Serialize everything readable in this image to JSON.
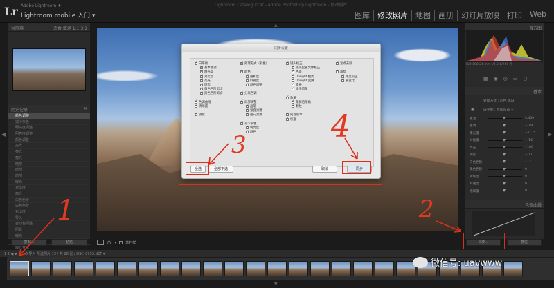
{
  "window_title": "Lightroom Catalog.lrcat - Adobe Photoshop Lightroom - 修改照片",
  "app": {
    "logo": "Lr",
    "subtitle": "Adobe Lightroom ♦",
    "identity": "Lightroom mobile 入门 ▾"
  },
  "nav": {
    "items": [
      {
        "label": "图库",
        "active": false
      },
      {
        "label": "修改照片",
        "active": true
      },
      {
        "label": "地图",
        "active": false
      },
      {
        "label": "画册",
        "active": false
      },
      {
        "label": "幻灯片放映",
        "active": false
      },
      {
        "label": "打印",
        "active": false
      },
      {
        "label": "Web",
        "active": false
      }
    ]
  },
  "left_panel": {
    "navigator_title": "导航器",
    "navigator_zoom": "适合 填满 1:1 3:1",
    "history_title": "历史记录",
    "history_items": [
      "颜色调整",
      "减少杂色",
      "明亮度调整",
      "明亮度调整",
      "颜色调整",
      "亮光",
      "亮光",
      "亮光",
      "暗部",
      "暗部",
      "暗部",
      "曝光",
      "对比度",
      "高光",
      "白色色阶",
      "白色色阶",
      "对比度",
      "导入",
      "自动色调整",
      "阴影",
      "曝光",
      "高光",
      "曝光变化",
      "曝光变化",
      "色温",
      "色调"
    ],
    "copy_button": "复制...",
    "paste_button": "粘贴"
  },
  "dialog": {
    "title": "同步设置",
    "col1": [
      "白平衡",
      "基本色调",
      "曝光度",
      "对比度",
      "高光",
      "阴影",
      "白色色阶剪切",
      "黑色色阶剪切",
      "色调曲线",
      "清晰度",
      "锐化"
    ],
    "col2": [
      "处理方式（彩色）",
      "颜色",
      "饱和度",
      "鲜艳度",
      "颜色调整",
      "分离色调",
      "局部调整",
      "画笔",
      "渐变滤镜",
      "径向滤镜",
      "减少杂色",
      "明亮度",
      "颜色"
    ],
    "col3": [
      "镜头校正",
      "镜头配置文件校正",
      "色差",
      "Upright 模式",
      "Upright 变换",
      "变换",
      "镜头暗角",
      "效果",
      "裁剪后暗角",
      "颗粒",
      "处理版本",
      "校准"
    ],
    "col4": [
      "污点去除",
      "裁剪",
      "角度校正",
      "长宽比"
    ],
    "select_all": "全选",
    "select_none": "全部不选",
    "cancel": "取消",
    "sync": "同步"
  },
  "right_panel": {
    "histogram_title": "直方图",
    "hist_info": "ISO 100  24 mm  f/8.0  1/250 秒",
    "basic_title": "基本",
    "treatment": "处理方式 : 彩色  黑白",
    "wb_label": "白平衡 : 原照设置 ÷",
    "rows": [
      {
        "label": "色温",
        "value": "4,450"
      },
      {
        "label": "色调",
        "value": "+ 19"
      },
      {
        "label": "曝光度",
        "value": "+ 0.25"
      },
      {
        "label": "对比度",
        "value": "+ 16"
      },
      {
        "label": "高光",
        "value": "- 100"
      },
      {
        "label": "阴影",
        "value": "+ 11"
      },
      {
        "label": "白色色阶",
        "value": "- 17"
      },
      {
        "label": "黑色色阶",
        "value": "0"
      },
      {
        "label": "清晰度",
        "value": "0"
      },
      {
        "label": "鲜艳度",
        "value": "0"
      },
      {
        "label": "饱和度",
        "value": "0"
      }
    ],
    "tone_curve_title": "色调曲线",
    "sync_button": "同步...",
    "reset_button": "复位"
  },
  "toolbar": {
    "soft_proof": "软打样"
  },
  "filmstrip": {
    "bar_text": "1  2  ◀ ▶  上一次导入  所选照片 13 / 共 28 张 / DSC_0953.NEF ▾",
    "thumb_count": 24,
    "selected_index": 0
  },
  "watermark": "微信号: uavwww",
  "annotations": [
    "1",
    "2",
    "3",
    "4"
  ],
  "colors": {
    "annotation": "#d9301e",
    "active_nav": "#e8e8e8"
  }
}
